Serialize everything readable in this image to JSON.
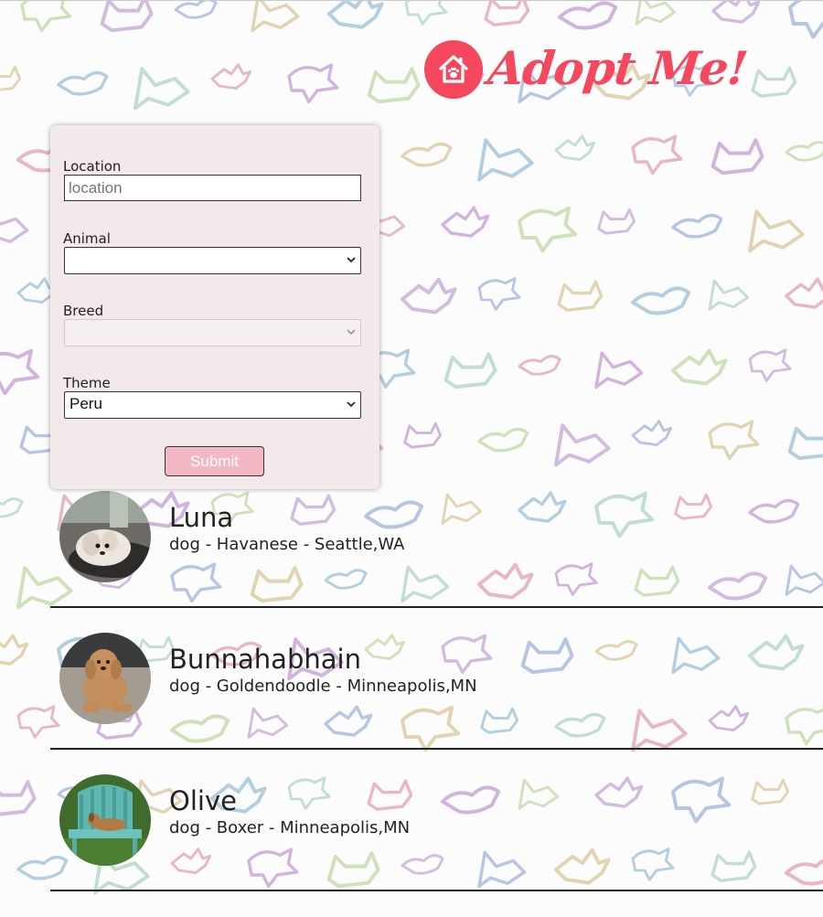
{
  "header": {
    "brand": "Adopt Me!",
    "logo_icon": "house-paw-icon",
    "accent": "#f5475e"
  },
  "form": {
    "location": {
      "label": "Location",
      "placeholder": "location",
      "value": ""
    },
    "animal": {
      "label": "Animal",
      "value": ""
    },
    "breed": {
      "label": "Breed",
      "value": "",
      "disabled": true
    },
    "theme": {
      "label": "Theme",
      "value": "Peru"
    },
    "submit_label": "Submit",
    "submit_color": "#f4b7c4"
  },
  "pets": [
    {
      "name": "Luna",
      "description": "dog - Havanese - Seattle,WA"
    },
    {
      "name": "Bunnahabhain",
      "description": "dog - Goldendoodle - Minneapolis,MN"
    },
    {
      "name": "Olive",
      "description": "dog - Boxer - Minneapolis,MN"
    }
  ]
}
